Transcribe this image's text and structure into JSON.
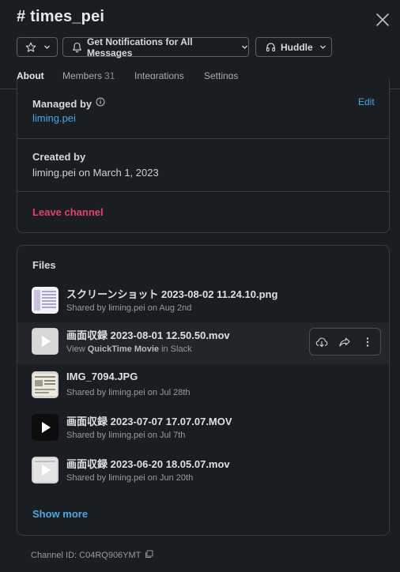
{
  "header": {
    "title": "# times_pei",
    "close_icon": "close-icon"
  },
  "toolbar": {
    "star_icon": "star-icon",
    "notifications_label": "Get Notifications for All Messages",
    "huddle_label": "Huddle"
  },
  "tabs": [
    {
      "label": "About",
      "active": true
    },
    {
      "label": "Members",
      "count": "31"
    },
    {
      "label": "Integrations"
    },
    {
      "label": "Settings"
    }
  ],
  "about": {
    "managed_by_label": "Managed by",
    "managed_by_value": "liming.pei",
    "edit_label": "Edit",
    "created_by_label": "Created by",
    "created_by_value": "liming.pei on March 1, 2023",
    "leave_label": "Leave channel"
  },
  "files": {
    "title": "Files",
    "items": [
      {
        "name": "スクリーンショット 2023-08-02 11.24.10.png",
        "meta": "Shared by liming.pei on Aug 2nd",
        "thumb": "screenshot"
      },
      {
        "name": "画面収録 2023-08-01 12.50.50.mov",
        "meta_prefix": "View",
        "meta_app": "QuickTime Movie",
        "meta_suffix": "in Slack",
        "thumb": "video-light"
      },
      {
        "name": "IMG_7094.JPG",
        "meta": "Shared by liming.pei on Jul 28th",
        "thumb": "photo"
      },
      {
        "name": "画面収録 2023-07-07 17.07.07.MOV",
        "meta": "Shared by liming.pei on Jul 7th",
        "thumb": "video-dark"
      },
      {
        "name": "画面収録 2023-06-20 18.05.07.mov",
        "meta": "Shared by liming.pei on Jun 20th",
        "thumb": "video-light"
      }
    ],
    "show_more": "Show more"
  },
  "footer": {
    "channel_id": "Channel ID: C04RQ906YMT"
  },
  "colors": {
    "background": "#1a1d21",
    "link": "#4ea5e0",
    "danger": "#e0426c",
    "border": "#3a3c40"
  }
}
